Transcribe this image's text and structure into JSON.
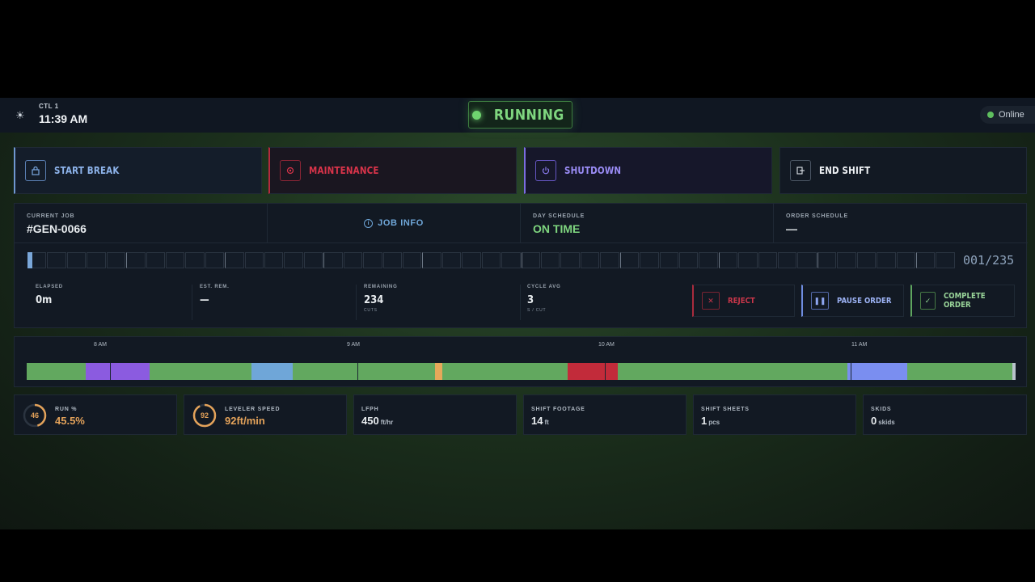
{
  "header": {
    "line": "CTL 1",
    "time": "11:39 AM",
    "status": "RUNNING",
    "connection": "Online"
  },
  "actions": [
    {
      "label": "START BREAK",
      "icon": "lock-icon",
      "color": "#7aa7e0"
    },
    {
      "label": "MAINTENANCE",
      "icon": "gear-icon",
      "color": "#d9344a"
    },
    {
      "label": "SHUTDOWN",
      "icon": "power-icon",
      "color": "#8b7cf0"
    },
    {
      "label": "END SHIFT",
      "icon": "logout-icon",
      "color": "#e8ecef"
    }
  ],
  "job": {
    "current_label": "CURRENT JOB",
    "current_value": "#GEN-0066",
    "info_label": "JOB INFO",
    "day_label": "DAY SCHEDULE",
    "day_value": "ON TIME",
    "order_label": "ORDER SCHEDULE",
    "order_value": "—",
    "counter": "001/235",
    "progress_fraction": 0.00426
  },
  "stats": [
    {
      "label": "ELAPSED",
      "value": "0m",
      "unit": ""
    },
    {
      "label": "EST. REM.",
      "value": "—",
      "unit": ""
    },
    {
      "label": "REMAINING",
      "value": "234",
      "unit": "CUTS"
    },
    {
      "label": "CYCLE AVG",
      "value": "3",
      "unit": "S / CUT"
    }
  ],
  "order_buttons": [
    {
      "label": "REJECT",
      "icon": "x-icon",
      "color": "#c9364a"
    },
    {
      "label": "PAUSE ORDER",
      "icon": "pause-icon",
      "color": "#8ea6f0"
    },
    {
      "label": "COMPLETE ORDER",
      "icon": "check-icon",
      "color": "#8fd18f"
    }
  ],
  "timeline": {
    "hours": [
      "8 AM",
      "9 AM",
      "10 AM",
      "11 AM"
    ],
    "colors": {
      "run": "#62a85f",
      "break": "#8b5be0",
      "idle": "#6fa6d8",
      "setup": "#e6a85a",
      "maintenance": "#c22b3a",
      "pause": "#7a8ef0",
      "now": "#b9c3cc"
    }
  },
  "kpis": [
    {
      "label": "RUN %",
      "value": "45.5%",
      "ring": "46",
      "ring_fraction": 0.455
    },
    {
      "label": "LEVELER SPEED",
      "value": "92ft/min",
      "ring": "92",
      "ring_fraction": 0.92
    },
    {
      "label": "LFPH",
      "value": "450",
      "unit": "ft/hr"
    },
    {
      "label": "SHIFT FOOTAGE",
      "value": "14",
      "unit": "ft"
    },
    {
      "label": "SHIFT SHEETS",
      "value": "1",
      "unit": "pcs"
    },
    {
      "label": "SKIDS",
      "value": "0",
      "unit": "skids"
    }
  ]
}
